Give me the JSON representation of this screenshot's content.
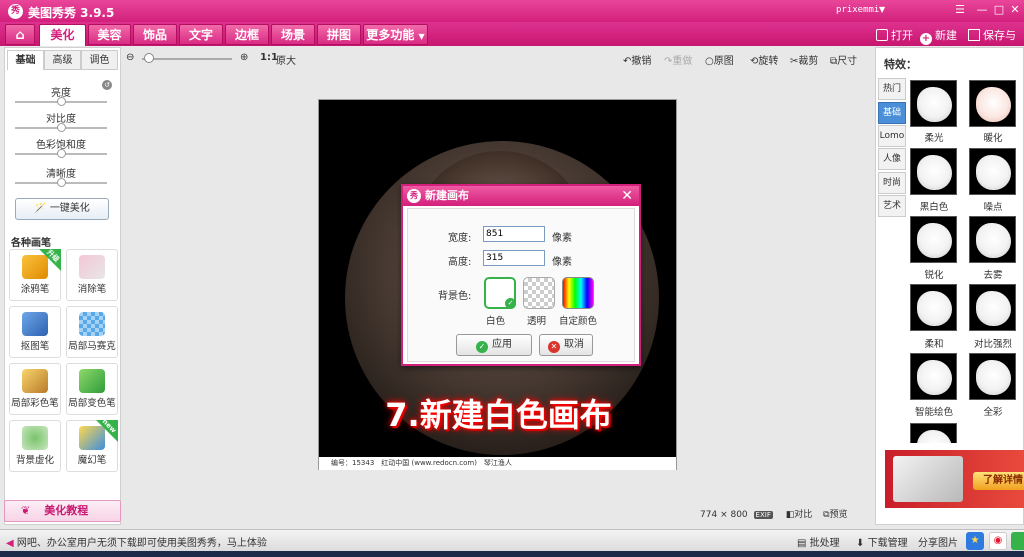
{
  "app": {
    "title": "美图秀秀 3.9.5",
    "logo_text": "秀",
    "username": "prixemmi"
  },
  "window_controls": {
    "menu": "▼",
    "minimize": "—",
    "maximize": "□",
    "close": "✕"
  },
  "main_tabs": [
    {
      "label": "⌂"
    },
    {
      "label": "美化"
    },
    {
      "label": "美容"
    },
    {
      "label": "饰品"
    },
    {
      "label": "文字"
    },
    {
      "label": "边框"
    },
    {
      "label": "场景"
    },
    {
      "label": "拼图"
    },
    {
      "label": "更多功能"
    }
  ],
  "file_actions": {
    "open": "打开",
    "new": "新建",
    "save": "保存与分"
  },
  "left_panel": {
    "subtabs": [
      "基础",
      "高级",
      "调色"
    ],
    "sliders": [
      {
        "label": "亮度",
        "value": 0.5
      },
      {
        "label": "对比度",
        "value": 0.5
      },
      {
        "label": "色彩饱和度",
        "value": 0.5
      },
      {
        "label": "清晰度",
        "value": 0.5
      }
    ],
    "one_key_label": "一键美化",
    "section_title": "各种画笔",
    "brushes": [
      {
        "label": "涂鸦笔",
        "badge": "升级"
      },
      {
        "label": "消除笔",
        "badge": ""
      },
      {
        "label": "抠图笔",
        "badge": ""
      },
      {
        "label": "局部马赛克",
        "badge": ""
      },
      {
        "label": "局部彩色笔",
        "badge": ""
      },
      {
        "label": "局部变色笔",
        "badge": ""
      },
      {
        "label": "背景虚化",
        "badge": ""
      },
      {
        "label": "魔幻笔",
        "badge": "new"
      }
    ],
    "tutorial_label": "美化教程"
  },
  "toolbar": {
    "zoom_ratio": "1:1",
    "original_size": "原大",
    "undo": "撤销",
    "redo": "重做",
    "original": "原图",
    "rotate": "旋转",
    "crop": "裁剪",
    "resize": "尺寸"
  },
  "canvas": {
    "caption": "7.新建白色画布",
    "footer": "编号：15343　红动中国 (www.redocn.com)　琴江渔人"
  },
  "dialog": {
    "title": "新建画布",
    "width_label": "宽度:",
    "width_value": "851",
    "height_label": "高度:",
    "height_value": "315",
    "unit": "像素",
    "bg_label": "背景色:",
    "options": [
      "白色",
      "透明",
      "自定颜色"
    ],
    "apply": "应用",
    "cancel": "取消"
  },
  "right_panel": {
    "title": "特效：",
    "categories": [
      "热门",
      "基础",
      "Lomo",
      "人像",
      "时尚",
      "艺术"
    ],
    "effects": [
      "柔光",
      "暖化",
      "黑白色",
      "噪点",
      "锐化",
      "去雾",
      "柔和",
      "对比强烈",
      "智能绘色",
      "全彩"
    ],
    "ad_button": "了解详情"
  },
  "status": {
    "width": "774",
    "x": "×",
    "height": "800",
    "exif": "EXIF",
    "compare": "对比",
    "preview": "预览"
  },
  "bottom_bar": {
    "message": "网吧、办公室用户无须下载即可使用美图秀秀，马上体验",
    "batch": "批处理",
    "download_manager": "下载管理",
    "share": "分享图片"
  },
  "colors": {
    "brand": "#d3207c",
    "accent_green": "#35b34a",
    "active_blue": "#4a8fd8"
  }
}
